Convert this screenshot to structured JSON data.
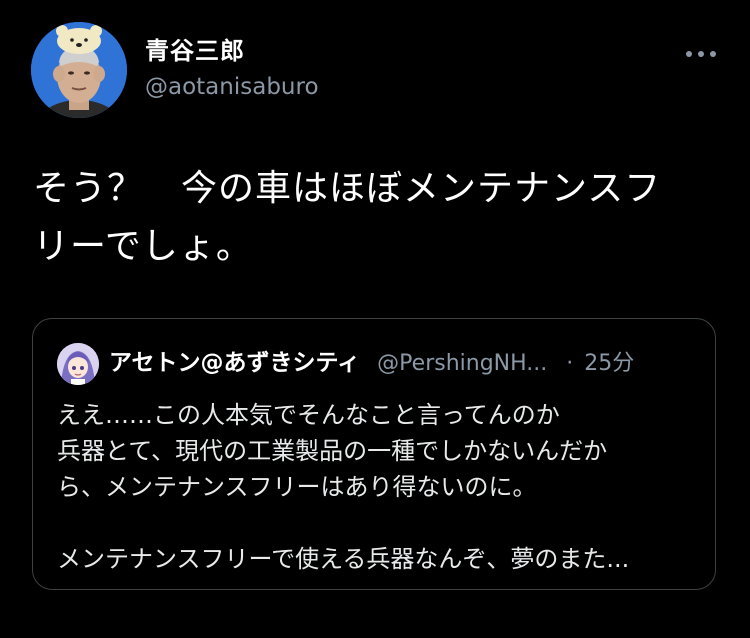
{
  "author": {
    "display_name": "青谷三郎",
    "handle": "@aotanisaburo",
    "avatar_icon": "user-avatar-photo"
  },
  "menu": {
    "icon": "more-horizontal-icon"
  },
  "tweet": {
    "lines": [
      "そう？　今の車はほぼメンテナンスフ",
      "リーでしょ。"
    ]
  },
  "quote": {
    "author_name": "アセトン@あずきシティ",
    "author_handle": "@PershingNH...",
    "separator": "·",
    "time": "25分",
    "avatar_icon": "anime-character-avatar",
    "lines": [
      "ええ……この人本気でそんなこと言ってんのか",
      "兵器とて、現代の工業製品の一種でしかないんだか",
      "ら、メンテナンスフリーはあり得ないのに。",
      "",
      "メンテナンスフリーで使える兵器なんぞ、夢のまた..."
    ]
  },
  "colors": {
    "background": "#000000",
    "text_primary": "#ffffff",
    "text_secondary": "#8b98a5",
    "border": "#3e4144"
  }
}
